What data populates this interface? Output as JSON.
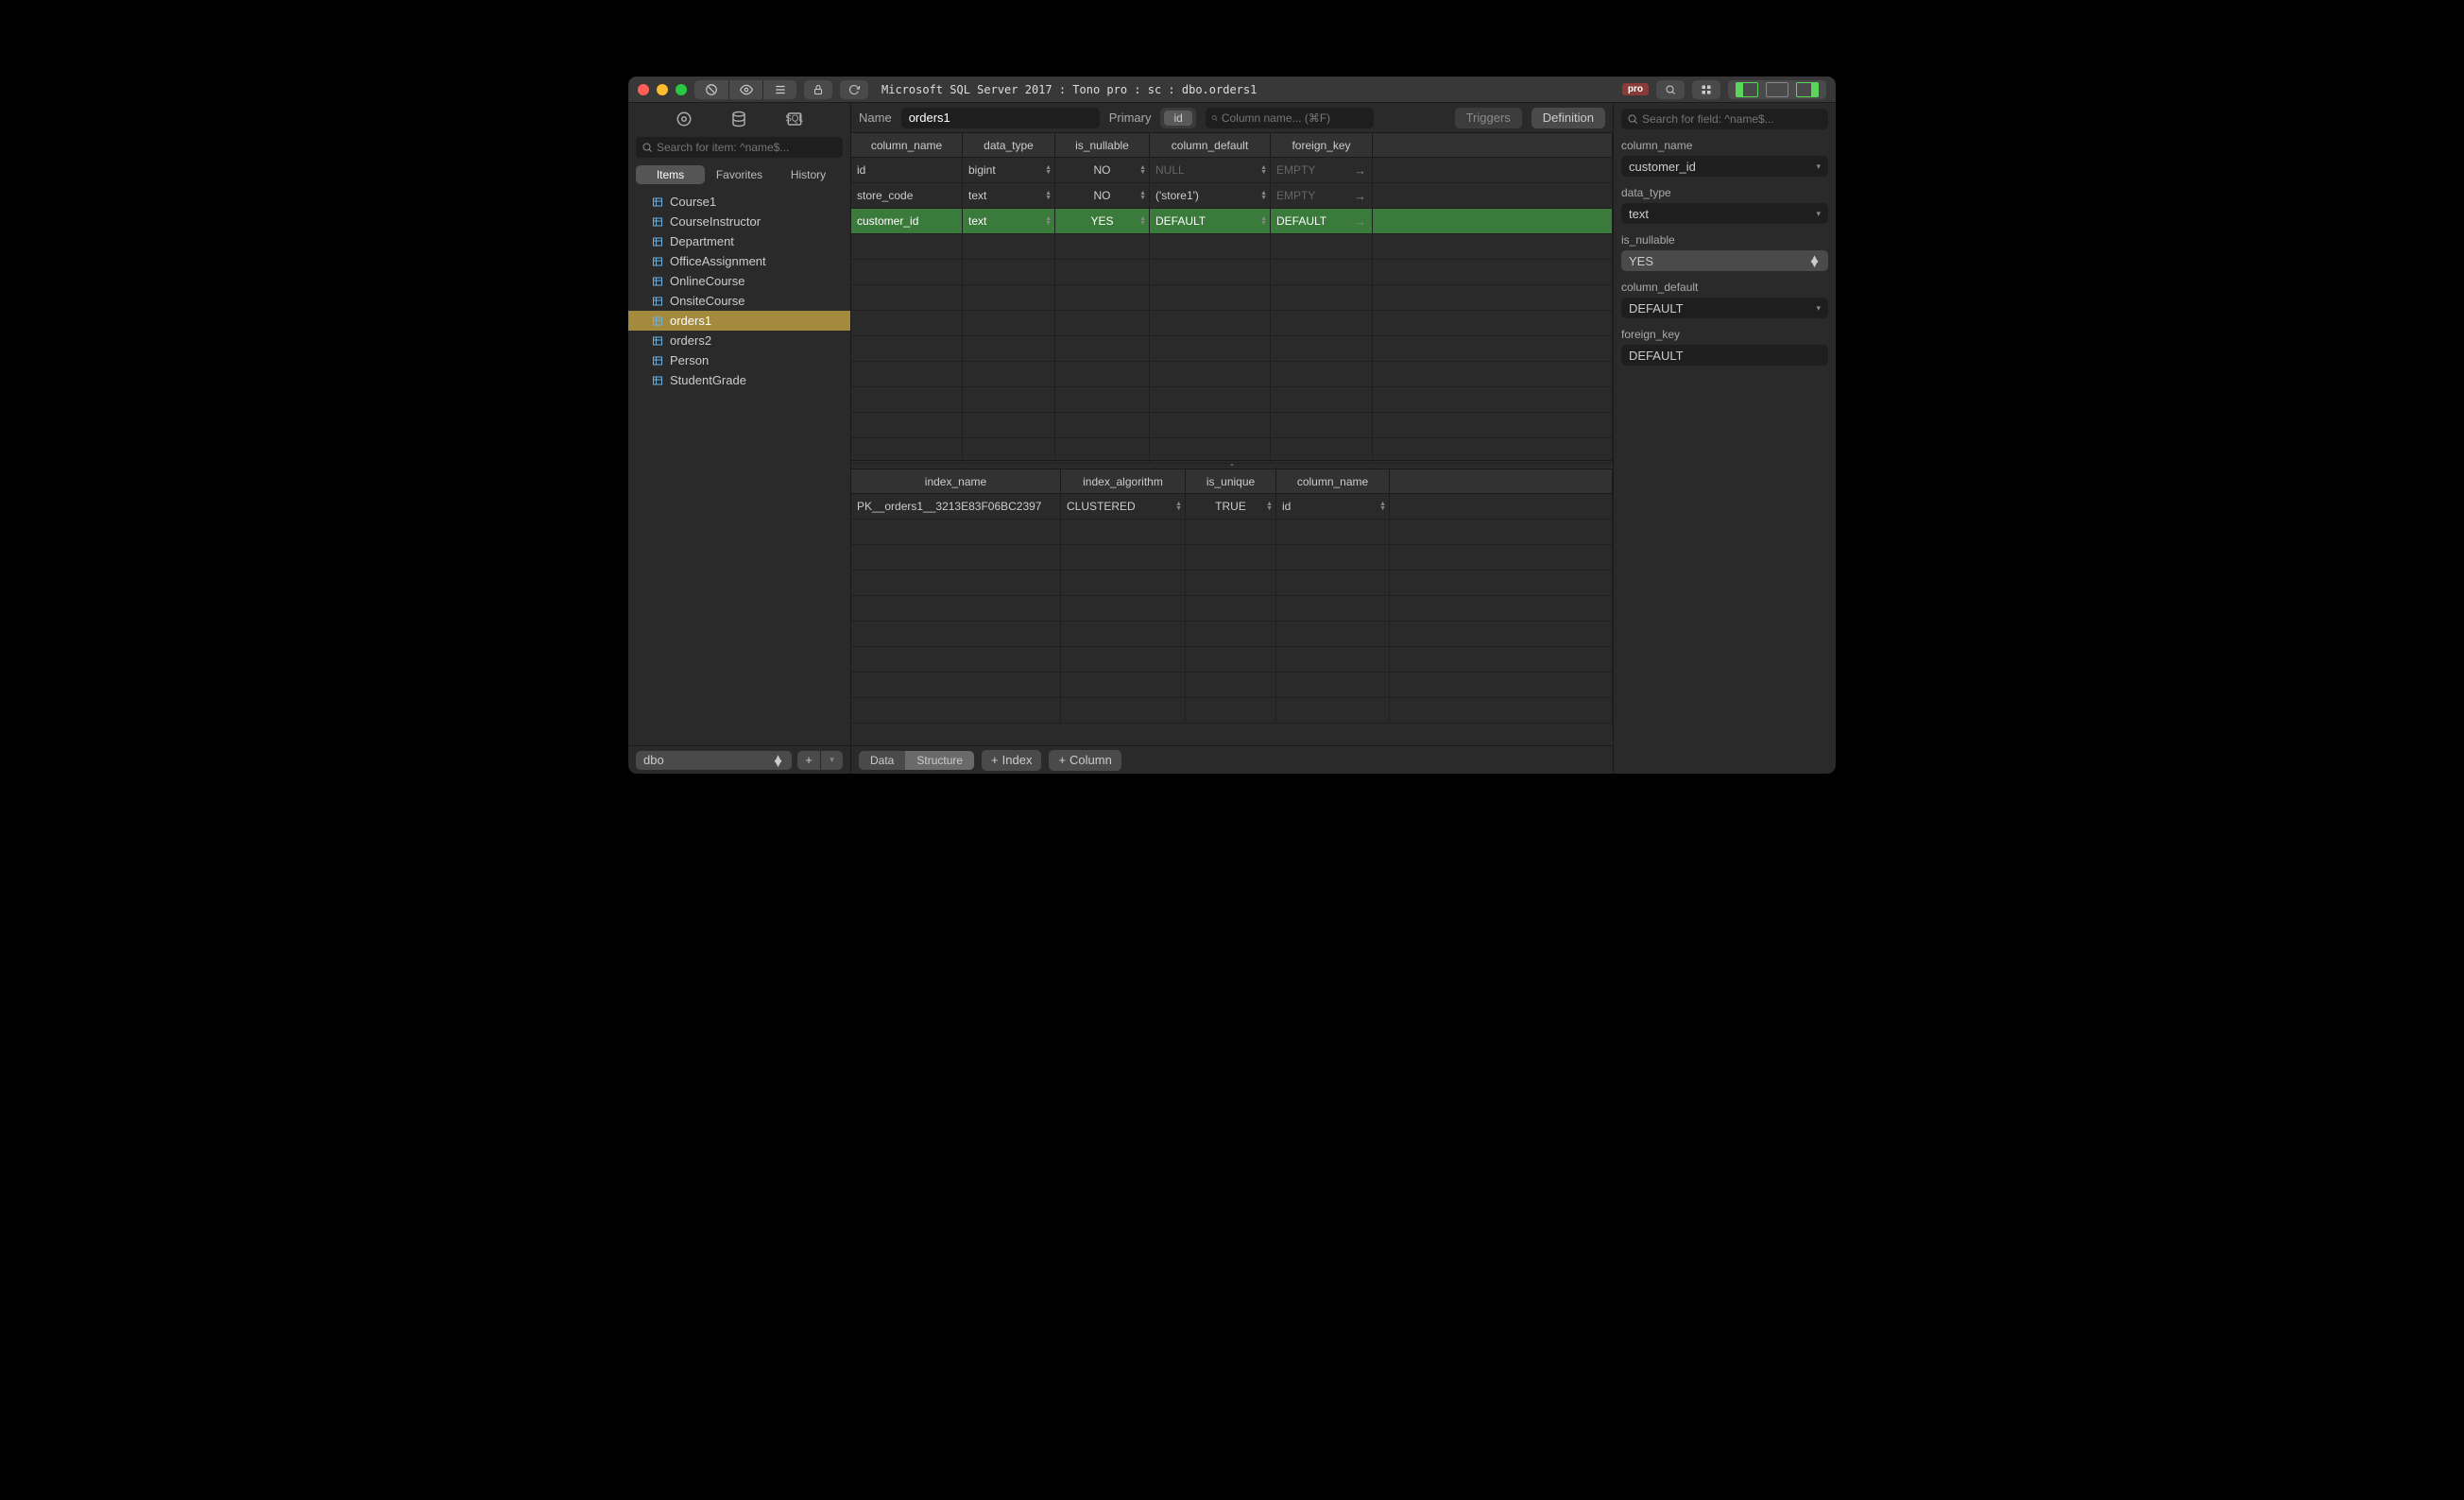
{
  "titlebar": {
    "path": "Microsoft SQL Server 2017 : Tono pro : sc : dbo.orders1",
    "pro_badge": "pro"
  },
  "sidebar": {
    "search_placeholder": "Search for item: ^name$...",
    "tabs": [
      "Items",
      "Favorites",
      "History"
    ],
    "active_tab": 0,
    "tables": [
      "Course1",
      "CourseInstructor",
      "Department",
      "OfficeAssignment",
      "OnlineCourse",
      "OnsiteCourse",
      "orders1",
      "orders2",
      "Person",
      "StudentGrade"
    ],
    "selected_table": "orders1",
    "schema": "dbo"
  },
  "controls": {
    "name_label": "Name",
    "name_value": "orders1",
    "primary_label": "Primary",
    "primary_value": "id",
    "col_search_placeholder": "Column name... (⌘F)",
    "triggers_btn": "Triggers",
    "definition_btn": "Definition"
  },
  "columns_header": [
    "column_name",
    "data_type",
    "is_nullable",
    "column_default",
    "foreign_key"
  ],
  "columns": [
    {
      "name": "id",
      "type": "bigint",
      "nullable": "NO",
      "default": "NULL",
      "default_ph": true,
      "fk": "EMPTY",
      "fk_ph": true
    },
    {
      "name": "store_code",
      "type": "text",
      "nullable": "NO",
      "default": "('store1')",
      "default_ph": false,
      "fk": "EMPTY",
      "fk_ph": true
    },
    {
      "name": "customer_id",
      "type": "text",
      "nullable": "YES",
      "default": "DEFAULT",
      "default_ph": false,
      "fk": "DEFAULT",
      "fk_ph": false,
      "selected": true
    }
  ],
  "indexes_header": [
    "index_name",
    "index_algorithm",
    "is_unique",
    "column_name"
  ],
  "indexes": [
    {
      "name": "PK__orders1__3213E83F06BC2397",
      "algorithm": "CLUSTERED",
      "unique": "TRUE",
      "column": "id"
    }
  ],
  "bottom": {
    "data_btn": "Data",
    "structure_btn": "Structure",
    "index_btn": "Index",
    "column_btn": "Column"
  },
  "inspector": {
    "search_placeholder": "Search for field: ^name$...",
    "fields": {
      "column_name": {
        "label": "column_name",
        "value": "customer_id"
      },
      "data_type": {
        "label": "data_type",
        "value": "text"
      },
      "is_nullable": {
        "label": "is_nullable",
        "value": "YES"
      },
      "column_default": {
        "label": "column_default",
        "value": "DEFAULT"
      },
      "foreign_key": {
        "label": "foreign_key",
        "value": "DEFAULT"
      }
    }
  }
}
